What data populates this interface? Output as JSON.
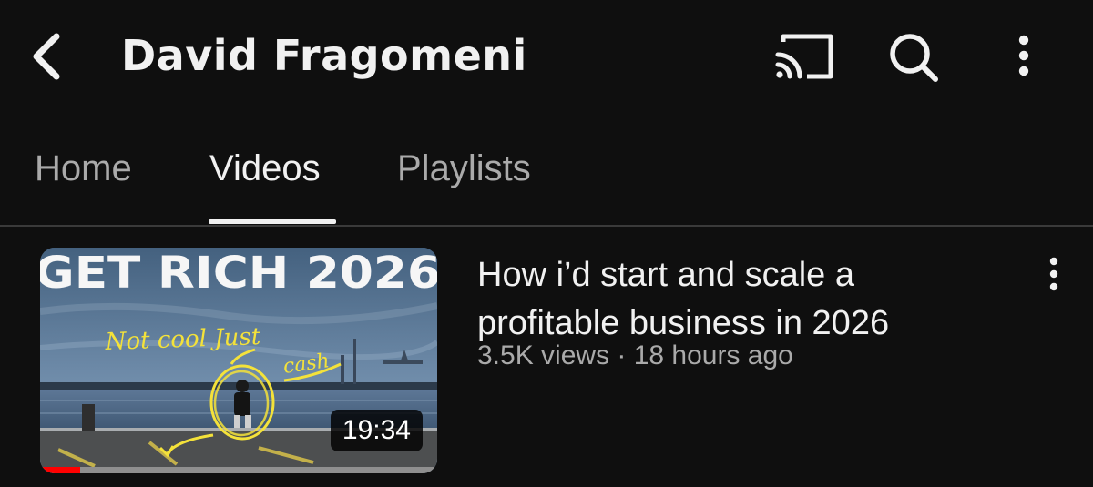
{
  "header": {
    "title": "David Fragomeni",
    "icons": [
      "back-arrow-icon",
      "cast-icon",
      "search-icon",
      "more-vertical-icon"
    ]
  },
  "tabs": [
    {
      "label": "Home",
      "active": false
    },
    {
      "label": "Videos",
      "active": true
    },
    {
      "label": "Playlists",
      "active": false
    }
  ],
  "videos": [
    {
      "title": "How i’d start and scale a profitable business in 2026",
      "meta": "3.5K views · 18 hours ago",
      "duration": "19:34",
      "watch_progress": 0.1,
      "thumbnail": {
        "headline": "GET RICH 2026",
        "handwriting_1": "Not cool Just",
        "handwriting_2": "cash"
      }
    }
  ],
  "colors": {
    "background": "#0f0f0f",
    "text_primary": "#f1f1f1",
    "text_secondary": "#aaaaaa",
    "progress": "#ff0000",
    "divider": "#3a3a3a"
  }
}
